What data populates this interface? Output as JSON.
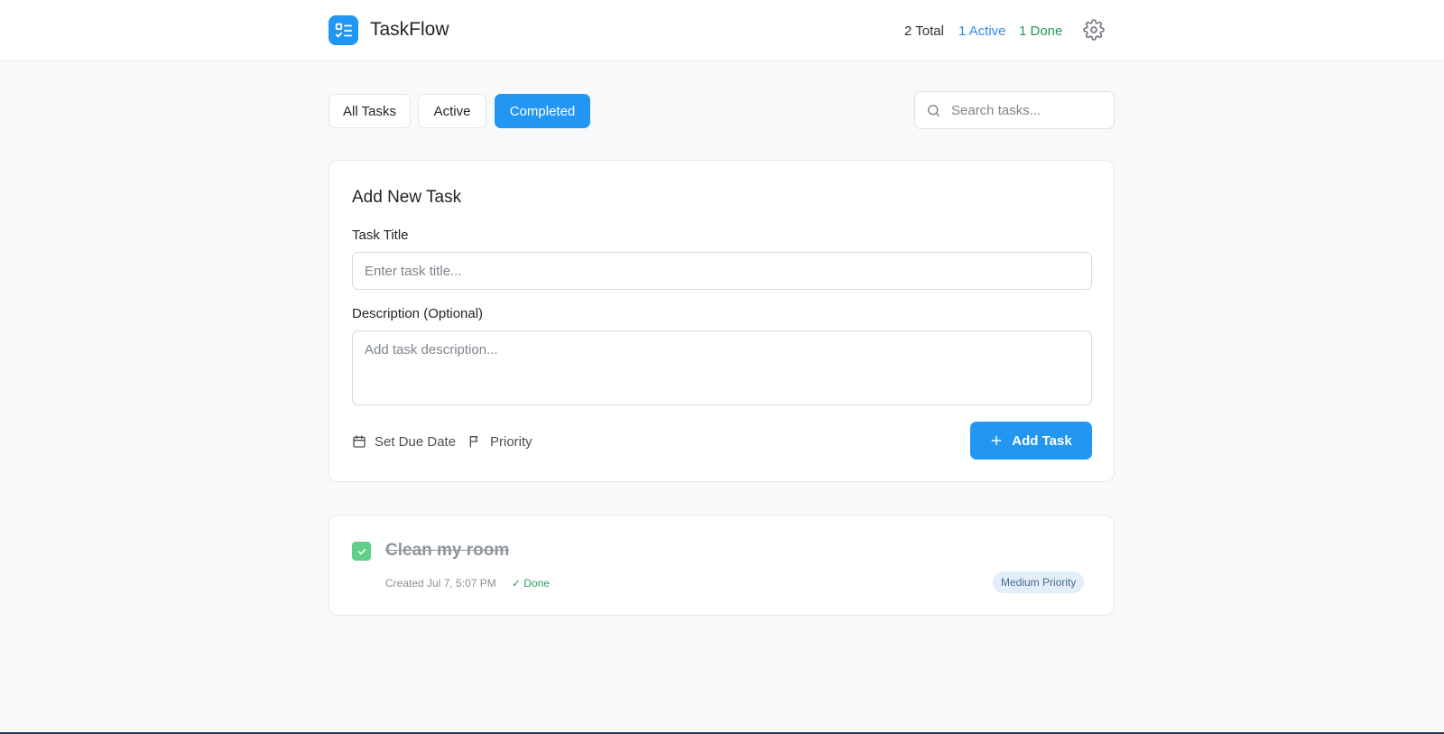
{
  "header": {
    "app_name": "TaskFlow",
    "stats": {
      "total": "2 Total",
      "active": "1 Active",
      "done": "1 Done"
    }
  },
  "filters": {
    "all": "All Tasks",
    "active": "Active",
    "completed": "Completed",
    "selected": "Completed"
  },
  "search": {
    "placeholder": "Search tasks..."
  },
  "add_task": {
    "heading": "Add New Task",
    "title_label": "Task Title",
    "title_placeholder": "Enter task title...",
    "description_label": "Description (Optional)",
    "description_placeholder": "Add task description...",
    "due_date_label": "Set Due Date",
    "priority_label": "Priority",
    "submit_label": "Add Task"
  },
  "tasks": [
    {
      "title": "Clean my room",
      "created": "Created Jul 7, 5:07 PM",
      "status": "✓ Done",
      "priority": "Medium Priority",
      "completed": true
    }
  ],
  "colors": {
    "accent": "#2196f3",
    "active": "#2f8de4",
    "done": "#1e9a57",
    "checkbox": "#5fd08a",
    "priority_bg": "#e3eefb"
  }
}
